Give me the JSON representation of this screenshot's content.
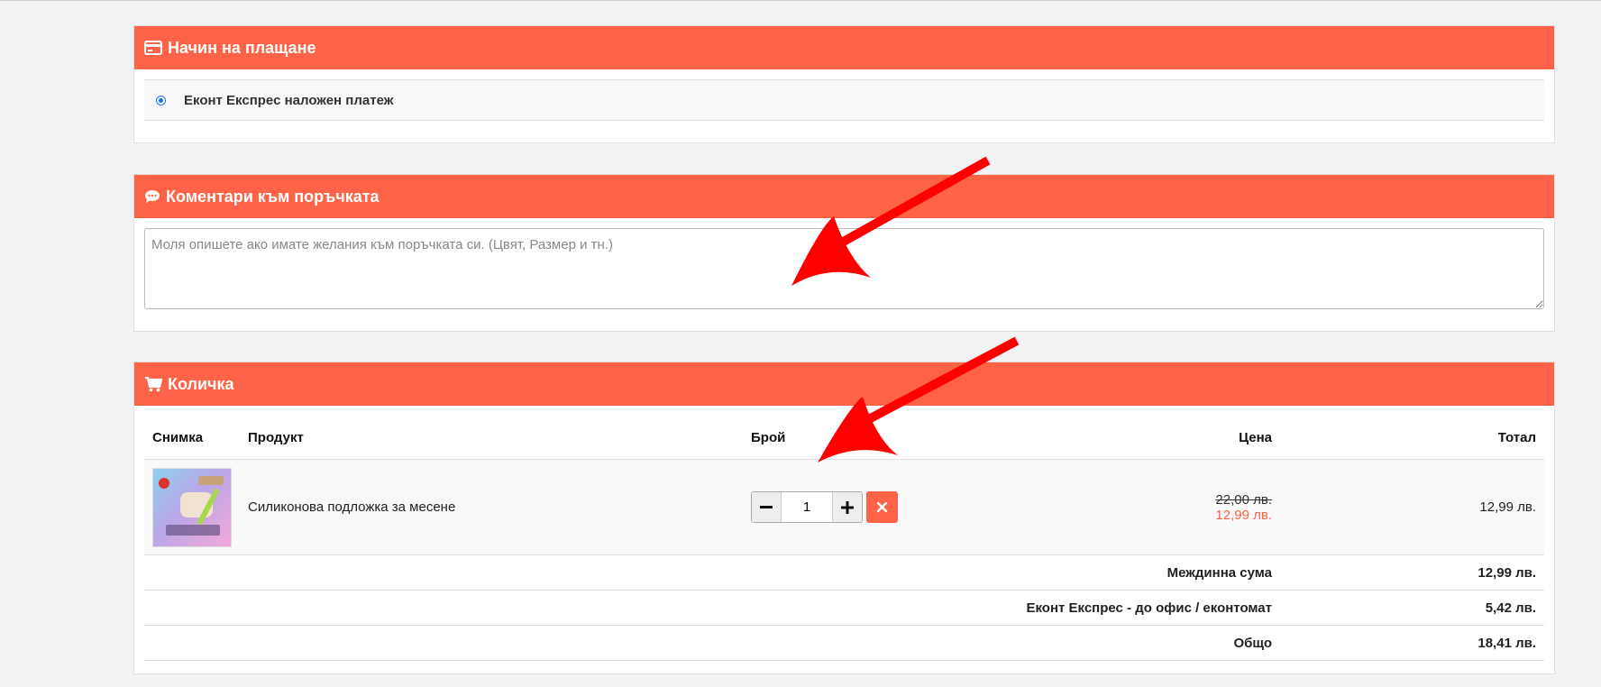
{
  "payment": {
    "title": "Начин на плащане",
    "option_label": "Еконт Експрес наложен платеж"
  },
  "comments": {
    "title": "Коментари към поръчката",
    "placeholder": "Моля опишете ако имате желания към поръчката си. (Цвят, Размер и тн.)"
  },
  "cart": {
    "title": "Количка",
    "headers": {
      "photo": "Снимка",
      "product": "Продукт",
      "qty": "Брой",
      "price": "Цена",
      "total": "Тотал"
    },
    "item": {
      "name": "Силиконова подложка за месене",
      "quantity": "1",
      "old_price": "22,00 лв.",
      "price": "12,99 лв.",
      "total": "12,99 лв."
    },
    "summary": [
      {
        "label": "Междинна сума",
        "value": "12,99 лв."
      },
      {
        "label": "Еконт Експрес - до офис / еконтомат",
        "value": "5,42 лв."
      },
      {
        "label": "Общо",
        "value": "18,41 лв."
      }
    ]
  },
  "colors": {
    "accent": "#ff6347",
    "arrow": "#ff0000",
    "radio": "#1a73e8"
  }
}
